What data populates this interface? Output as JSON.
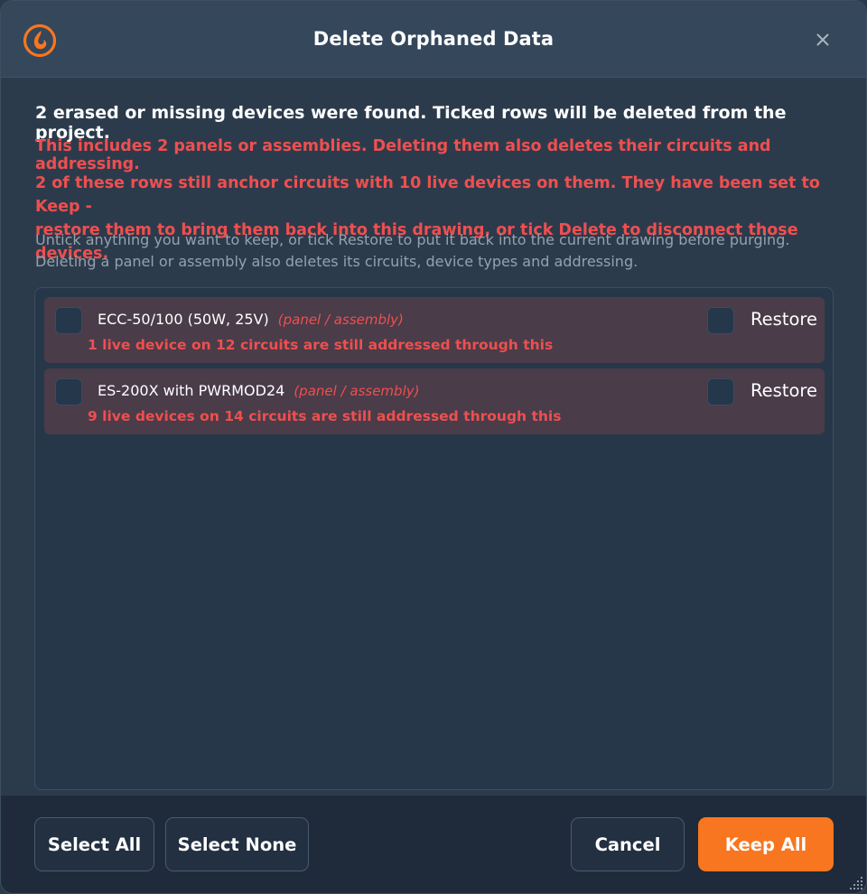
{
  "window": {
    "title": "Delete Orphaned Data",
    "close_icon": "close-icon"
  },
  "messages": {
    "main": "2 erased or missing devices were found. Ticked rows will be deleted from the project.",
    "warn_panels": "This includes 2 panels or assemblies. Deleting them also deletes their circuits and addressing.",
    "warn_anchor_line1": "2 of these rows still anchor circuits with 10 live devices on them. They have been set to Keep -",
    "warn_anchor_line2": "restore them to bring them back into this drawing, or tick Delete to disconnect those devices.",
    "hint_line1": "Untick anything you want to keep, or tick Restore to put it back into the current drawing before purging.",
    "hint_line2": "Deleting a panel or assembly also deletes its circuits, device types and addressing."
  },
  "items": [
    {
      "name": "ECC-50/100 (50W, 25V)",
      "type": "(panel / assembly)",
      "warning": "1 live device on 12 circuits are still addressed through this",
      "restore_label": "Restore",
      "delete_checked": false,
      "restore_checked": false
    },
    {
      "name": "ES-200X with PWRMOD24",
      "type": "(panel / assembly)",
      "warning": "9 live devices on 14 circuits are still addressed through this",
      "restore_label": "Restore",
      "delete_checked": false,
      "restore_checked": false
    }
  ],
  "footer": {
    "select_all": "Select All",
    "select_none": "Select None",
    "cancel": "Cancel",
    "keep_all": "Keep All"
  },
  "colors": {
    "accent": "#f8761f",
    "warning": "#ef4f4f",
    "background": "#2c3b4c",
    "row_flagged": "#4a3c49"
  }
}
